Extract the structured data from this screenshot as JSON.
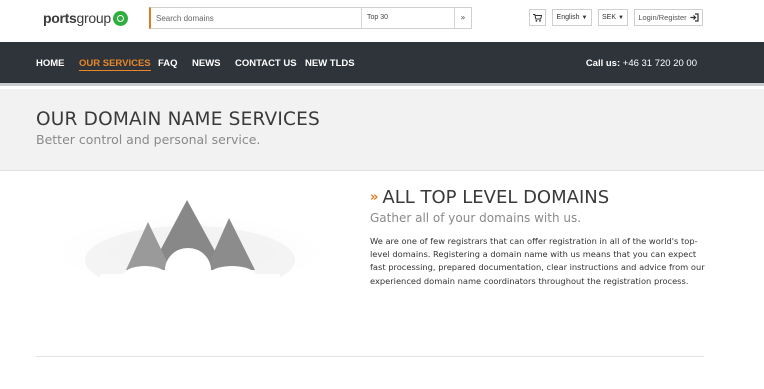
{
  "brand": {
    "name_bold": "ports",
    "name_light": "group"
  },
  "search": {
    "placeholder": "Search domains",
    "tld_selected": "Top 30",
    "go_label": "»"
  },
  "toolbar": {
    "cart_icon": "cart-icon",
    "language": "English",
    "currency": "SEK",
    "login_label": "Login/Register"
  },
  "nav": {
    "items": [
      {
        "label": "HOME"
      },
      {
        "label": "OUR SERVICES"
      },
      {
        "label": "FAQ"
      },
      {
        "label": "NEWS"
      },
      {
        "label": "CONTACT US"
      },
      {
        "label": "NEW TLDS"
      }
    ],
    "phone_label": "Call us:",
    "phone_number": "+46 31 720 20 00"
  },
  "page": {
    "title": "OUR DOMAIN NAME SERVICES",
    "subtitle": "Better control and personal service."
  },
  "section": {
    "chevron": "»",
    "title": "ALL TOP LEVEL DOMAINS",
    "subtitle": "Gather all of your domains with us.",
    "body": "We are one of few registrars that can offer registration in all of the world's top-level domains. Registering a domain name with us means that you can expect fast processing, prepared documentation, clear instructions and advice from our experienced domain name coordinators throughout the registration process."
  },
  "colors": {
    "accent": "#e7862a",
    "nav_bg": "#2f343b",
    "logo_green": "#2fae3f"
  }
}
